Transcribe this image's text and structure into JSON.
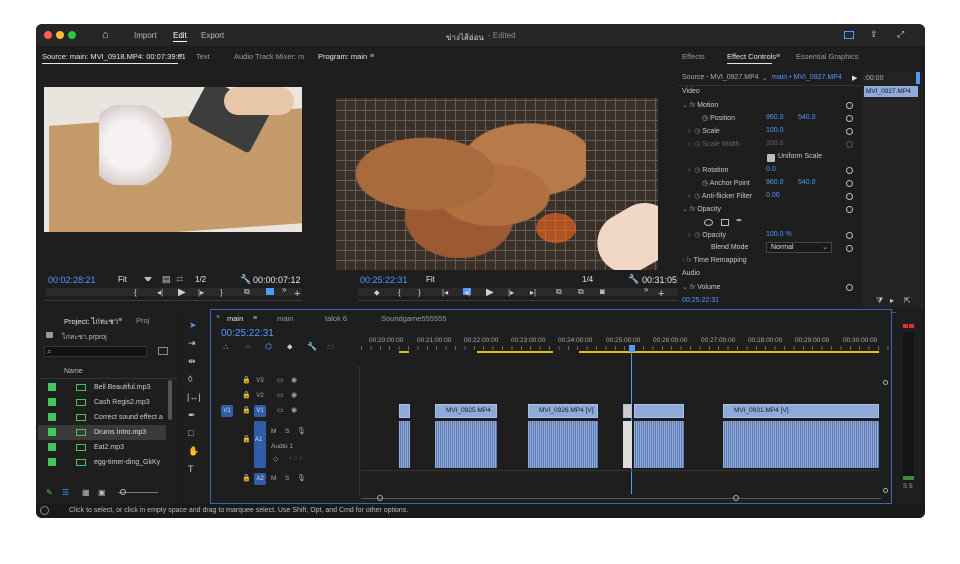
{
  "titlebar": {
    "tabs": [
      "Import",
      "Edit",
      "Export"
    ],
    "title": "ข่างไส้อ่อน",
    "edited": "- Edited"
  },
  "source": {
    "tabs": [
      "Source: main: MVI_0918.MP4: 00:07:39:01",
      "Text",
      "Audio Track Mixer: m"
    ],
    "tc_left": "00:02:28:21",
    "fit": "Fit",
    "res": "1/2",
    "tc_right": "00:00:07:12"
  },
  "program": {
    "tab": "Program: main",
    "tc_left": "00:25:22:31",
    "fit": "Fit",
    "res": "1/4",
    "tc_right": "00:31:05:38"
  },
  "effects": {
    "tabs": [
      "Effects",
      "Effect Controls",
      "Essential Graphics"
    ],
    "source_label": "Source - MVI_0927.MP4",
    "seq_label": "main • MVI_0927.MP4",
    "ruler_tc": ":00:00",
    "clip_label": "MVI_0927.MP4",
    "section_video": "Video",
    "motion": "Motion",
    "position_label": "Position",
    "position_x": "960.0",
    "position_y": "540.0",
    "scale_label": "Scale",
    "scale_val": "100.0",
    "scale_width_label": "Scale Width",
    "scale_width_val": "100.0",
    "uniform_label": "Uniform Scale",
    "rotation_label": "Rotation",
    "rotation_val": "0.0",
    "anchor_label": "Anchor Point",
    "anchor_x": "960.0",
    "anchor_y": "540.0",
    "flicker_label": "Anti-flicker Filter",
    "flicker_val": "0.00",
    "opacity_section": "Opacity",
    "opacity_label": "Opacity",
    "opacity_val": "100.0 %",
    "blend_label": "Blend Mode",
    "blend_val": "Normal",
    "time_remap": "Time Remapping",
    "section_audio": "Audio",
    "volume": "Volume",
    "bottom_tc": "00:25:22:31"
  },
  "project": {
    "tabs": [
      "Project: ไก่ทะชา",
      "Proj"
    ],
    "file": "ไก่ทะชา.prproj",
    "col_name": "Name",
    "items": [
      "Bell Beautiful.mp3",
      "Cash Regis2.mp3",
      "Correct sound effect a",
      "Drums Intro.mp3",
      "Eat2.mp3",
      "egg-timer-ding_GkKy"
    ]
  },
  "timeline": {
    "tabs": [
      "main",
      "main",
      "talok 6",
      "Soundgame555555"
    ],
    "tc": "00:25:22:31",
    "ruler": [
      "00:20:00:00",
      "00:21:00:00",
      "00:22:00:00",
      "00:23:00:00",
      "00:24:00:00",
      "00:25:00:00",
      "00:26:00:00",
      "00:27:00:00",
      "00:28:00:00",
      "00:29:00:00",
      "00:30:00:00"
    ],
    "tracks": {
      "v3": "V3",
      "v2": "V2",
      "v1": "V1",
      "a1": "A1",
      "a1_name": "Audio 1",
      "a2": "A2",
      "m": "M",
      "s": "S"
    },
    "clips": [
      "MVI_0925.MP4",
      "MVI_0926.MP4 [V]",
      "MVI_0931.MP4 [V]"
    ],
    "meter": "S S"
  },
  "status": "Click to select, or click in empty space and drag to marquee select. Use Shift, Opt, and Cmd for other options.",
  "colors": {
    "accent": "#4f9bff",
    "clip_video": "#8fa9d8",
    "clip_audio": "#5a79b5",
    "timeline_border": "#3a68b8"
  }
}
